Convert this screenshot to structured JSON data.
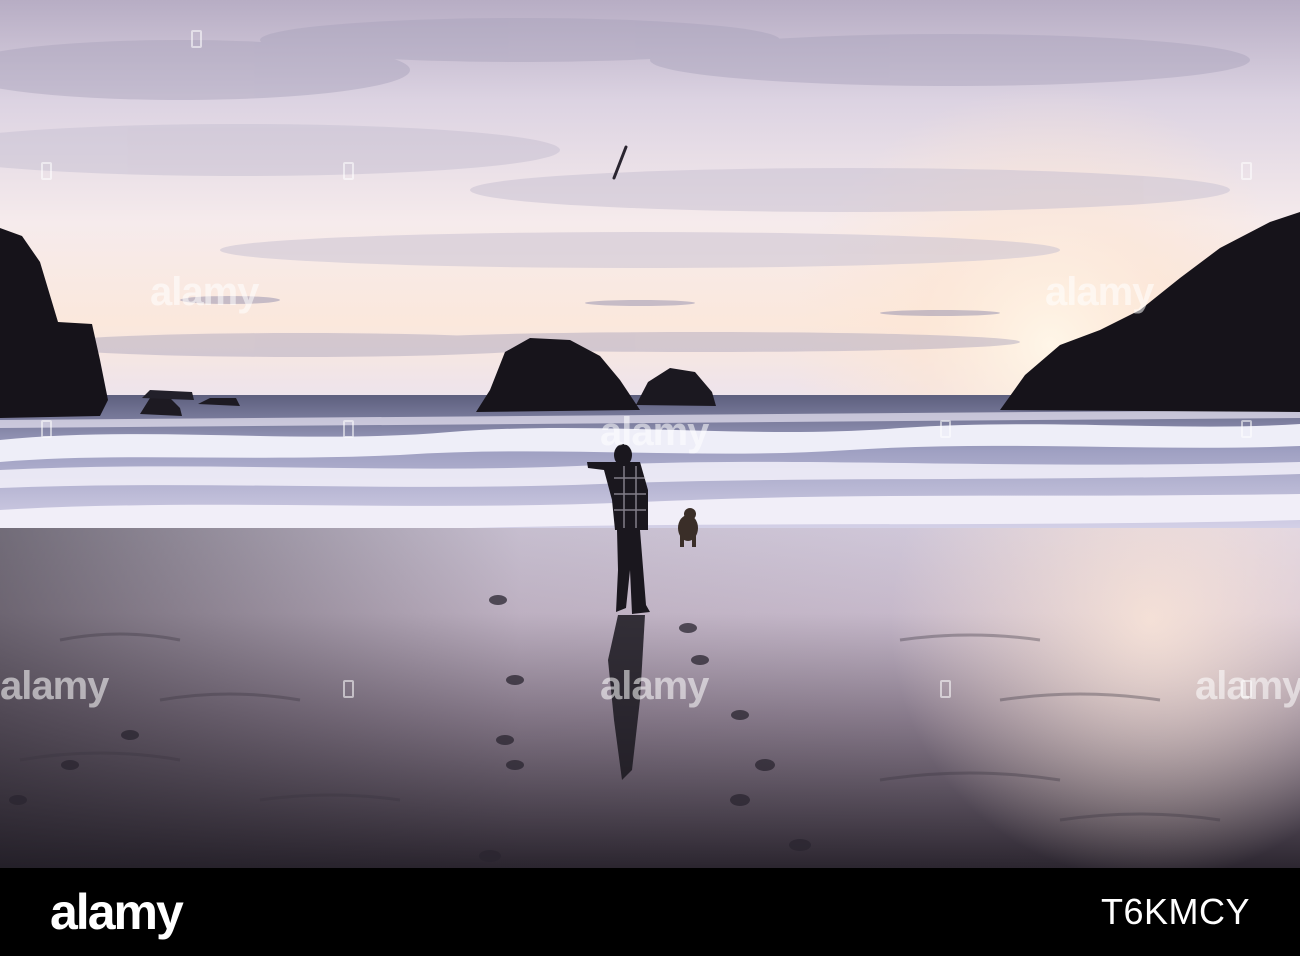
{
  "photo": {
    "subject": "man-throwing-stick-for-dog-on-beach-at-sunset",
    "colors": {
      "sky_top": "#c9bfd3",
      "sky_glow": "#fbe5d8",
      "ocean": "#c7c7e0",
      "sand_reflect": "#e7d6e6",
      "sand_dark": "#2c2833",
      "rock": "#16131a"
    }
  },
  "watermark": {
    "text": "alamy"
  },
  "footer": {
    "brand": "alamy",
    "image_id": "T6KMCY"
  }
}
